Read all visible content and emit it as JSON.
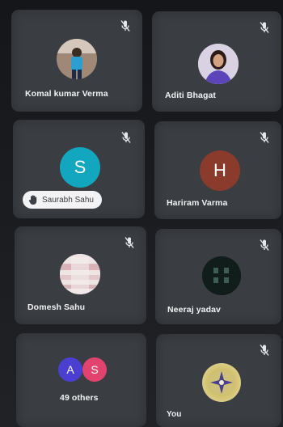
{
  "tiles": [
    {
      "name": "Komal kumar Verma",
      "muted": true,
      "avatar": "photo"
    },
    {
      "name": "Aditi Bhagat",
      "muted": true,
      "avatar": "photo"
    },
    {
      "name": "Saurabh Sahu",
      "muted": true,
      "avatar": "letter",
      "initial": "S",
      "color": "#12a7bf",
      "hand_raised": true
    },
    {
      "name": "Hariram Varma",
      "muted": true,
      "avatar": "letter",
      "initial": "H",
      "color": "#8a3b2c"
    },
    {
      "name": "Domesh Sahu",
      "muted": true,
      "avatar": "photo"
    },
    {
      "name": "Neeraj yadav",
      "muted": true,
      "avatar": "photo"
    },
    {
      "name": "49 others",
      "avatars": [
        {
          "initial": "A",
          "color": "#4b3fd1"
        },
        {
          "initial": "S",
          "color": "#e2436e"
        }
      ]
    },
    {
      "name": "You",
      "muted": true,
      "avatar": "photo"
    }
  ],
  "icons": {
    "mute": "mic-off-icon",
    "hand": "raised-hand-icon"
  }
}
